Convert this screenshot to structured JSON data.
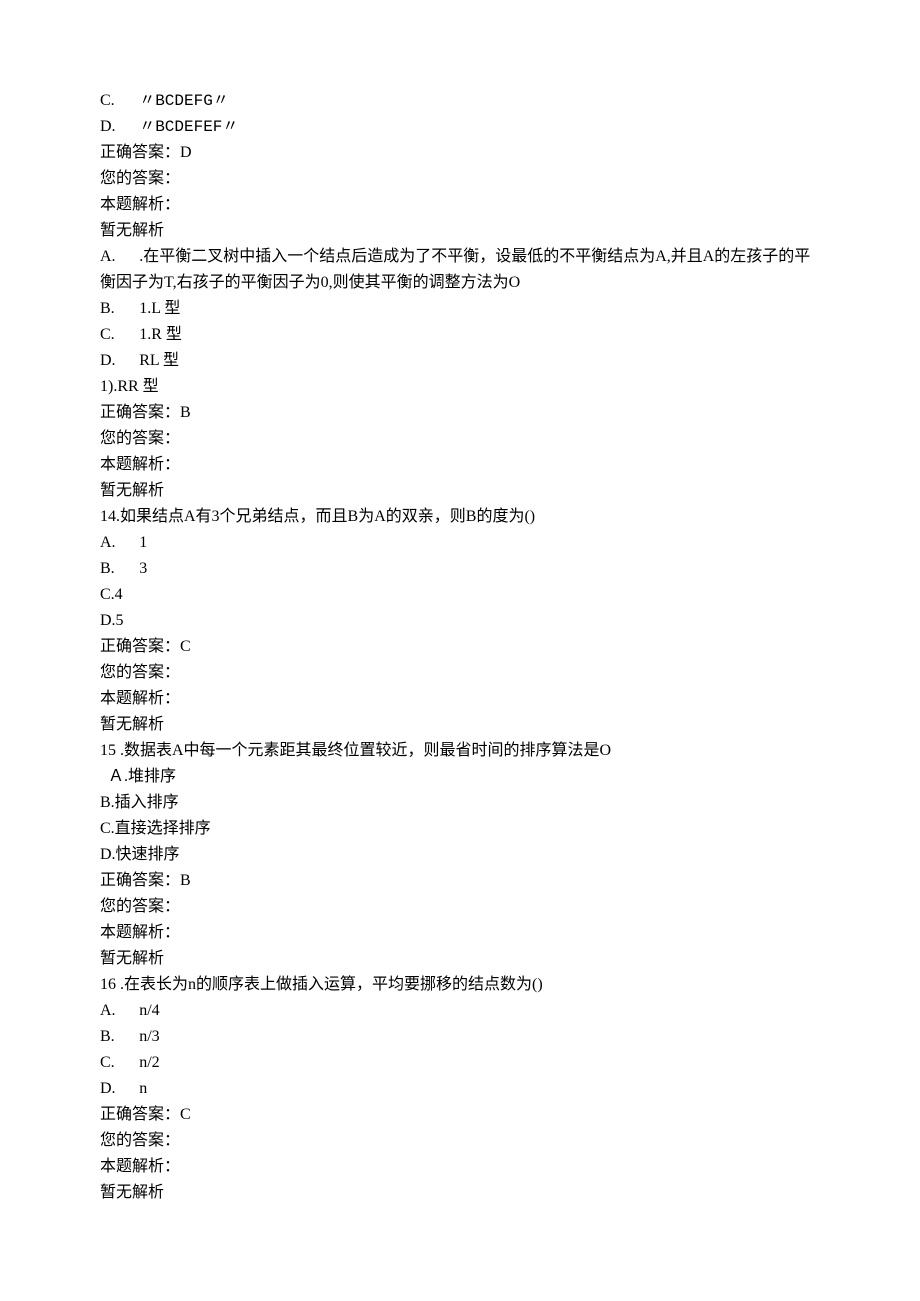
{
  "q12": {
    "optC_letter": "C.",
    "optC_text": "〃BCDEFG〃",
    "optD_letter": "D.",
    "optD_text": "〃BCDEFEF〃",
    "correct": "正确答案：D",
    "your": "您的答案：",
    "explain_label": "本题解析：",
    "explain_text": "暂无解析"
  },
  "q13": {
    "lineA_letter": "A.",
    "lineA_text": ".在平衡二叉树中插入一个结点后造成为了不平衡，设最低的不平衡结点为A,并且A的左孩子的平衡因子为T,右孩子的平衡因子为0,则使其平衡的调整方法为O",
    "optB_letter": "B.",
    "optB_text": "1.L 型",
    "optC_letter": "C.",
    "optC_text": "1.R 型",
    "optD_letter": "D.",
    "optD_text": "RL 型",
    "opt1_text": "1).RR 型",
    "correct": "正确答案：B",
    "your": "您的答案：",
    "explain_label": "本题解析：",
    "explain_text": "暂无解析"
  },
  "q14": {
    "stem": "14.如果结点A有3个兄弟结点，而且B为A的双亲，则B的度为()",
    "optA_letter": "A.",
    "optA_text": "1",
    "optB_letter": "B.",
    "optB_text": "3",
    "optC": "C.4",
    "optD": "D.5",
    "correct": "正确答案：C",
    "your": "您的答案：",
    "explain_label": "本题解析：",
    "explain_text": "暂无解析"
  },
  "q15": {
    "stem": "15 .数据表A中每一个元素距其最终位置较近，则最省时间的排序算法是O",
    "optA": "Ａ.堆排序",
    "optB": "B.插入排序",
    "optC": "C.直接选择排序",
    "optD": "D.快速排序",
    "correct": "正确答案：B",
    "your": "您的答案：",
    "explain_label": "本题解析：",
    "explain_text": "暂无解析"
  },
  "q16": {
    "stem": "16 .在表长为n的顺序表上做插入运算，平均要挪移的结点数为()",
    "optA_letter": "A.",
    "optA_text": "n/4",
    "optB_letter": "B.",
    "optB_text": "n/3",
    "optC_letter": "C.",
    "optC_text": "n/2",
    "optD_letter": "D.",
    "optD_text": "n",
    "correct": "正确答案：C",
    "your": "您的答案：",
    "explain_label": "本题解析：",
    "explain_text": "暂无解析"
  }
}
